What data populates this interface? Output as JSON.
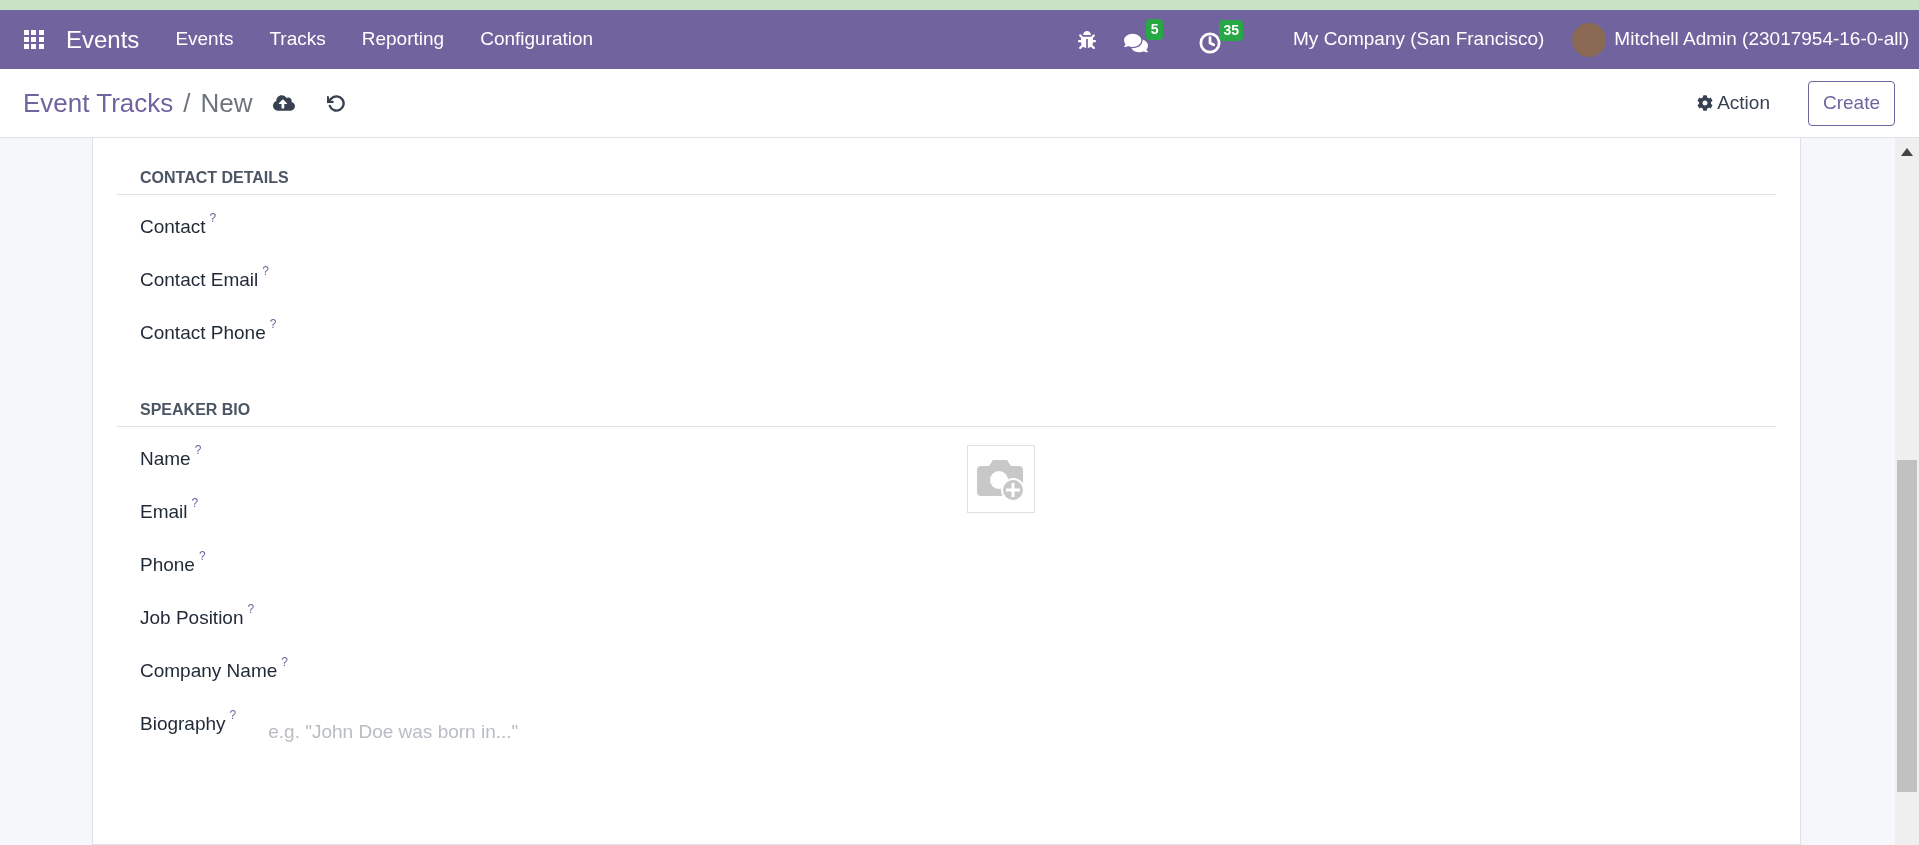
{
  "navbar": {
    "app_name": "Events",
    "menu": [
      "Events",
      "Tracks",
      "Reporting",
      "Configuration"
    ],
    "messages_count": "5",
    "activities_count": "35",
    "company": "My Company (San Francisco)",
    "user": "Mitchell Admin (23017954-16-0-all)"
  },
  "breadcrumb": {
    "parent": "Event Tracks",
    "separator": "/",
    "current": "New"
  },
  "actions": {
    "action": "Action",
    "create": "Create"
  },
  "sections": [
    {
      "title": "CONTACT DETAILS",
      "fields": [
        {
          "label": "Contact",
          "help": "?"
        },
        {
          "label": "Contact Email",
          "help": "?"
        },
        {
          "label": "Contact Phone",
          "help": "?"
        }
      ]
    },
    {
      "title": "SPEAKER BIO",
      "has_image": true,
      "fields": [
        {
          "label": "Name",
          "help": "?"
        },
        {
          "label": "Email",
          "help": "?"
        },
        {
          "label": "Phone",
          "help": "?"
        },
        {
          "label": "Job Position",
          "help": "?"
        },
        {
          "label": "Company Name",
          "help": "?"
        },
        {
          "label": "Biography",
          "help": "?",
          "placeholder": "e.g. \"John Doe was born in...\""
        }
      ]
    }
  ]
}
